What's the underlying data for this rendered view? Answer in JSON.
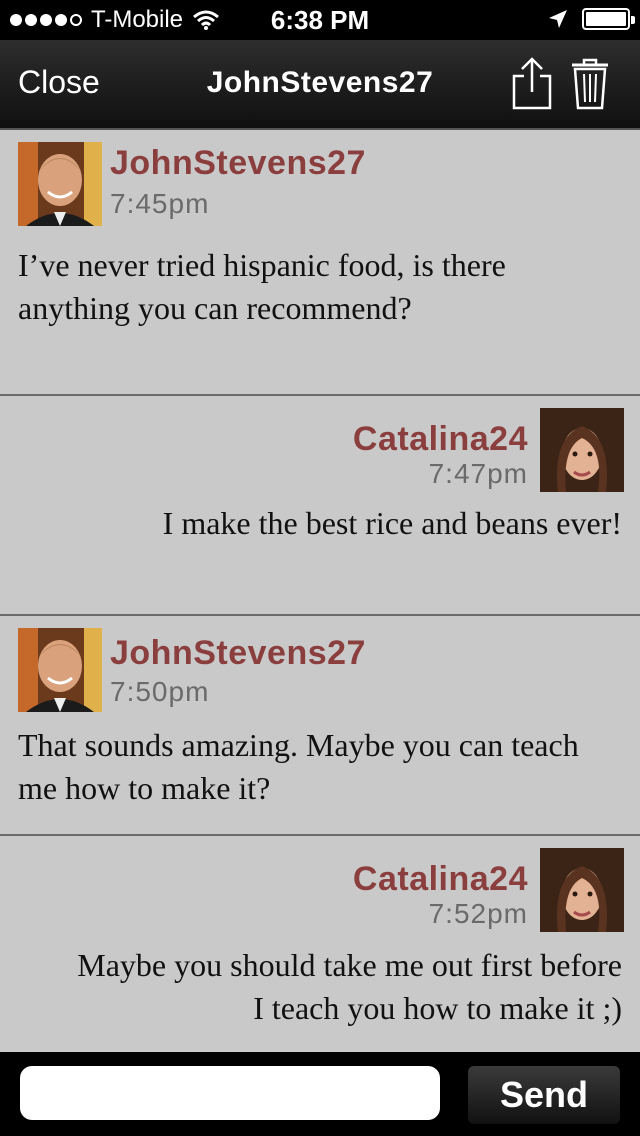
{
  "status_bar": {
    "carrier": "T-Mobile",
    "time": "6:38 PM",
    "signal_bars_filled": 4,
    "signal_bars_total": 5,
    "battery_level": 1.0,
    "icons": [
      "signal-dots-icon",
      "wifi-icon",
      "location-arrow-icon",
      "battery-icon"
    ]
  },
  "nav": {
    "close_label": "Close",
    "title": "JohnStevens27",
    "icons": [
      "share-icon",
      "trash-icon"
    ]
  },
  "messages": [
    {
      "sender": "JohnStevens27",
      "time": "7:45pm",
      "align": "left",
      "lines": [
        "I’ve never tried hispanic food, is there",
        "anything you can recommend?"
      ]
    },
    {
      "sender": "Catalina24",
      "time": "7:47pm",
      "align": "right",
      "lines": [
        "I make the best rice and beans ever!"
      ]
    },
    {
      "sender": "JohnStevens27",
      "time": "7:50pm",
      "align": "left",
      "lines": [
        "That sounds amazing. Maybe you can teach",
        "me how to make it?"
      ]
    },
    {
      "sender": "Catalina24",
      "time": "7:52pm",
      "align": "right",
      "lines": [
        "Maybe you should take me out first before",
        "I teach you how to make it ;)"
      ]
    }
  ],
  "composer": {
    "input_value": "",
    "send_label": "Send"
  },
  "colors": {
    "background": "#c9c9c9",
    "sender_name": "#8b3e3e",
    "timestamp": "#6a6a6a"
  }
}
